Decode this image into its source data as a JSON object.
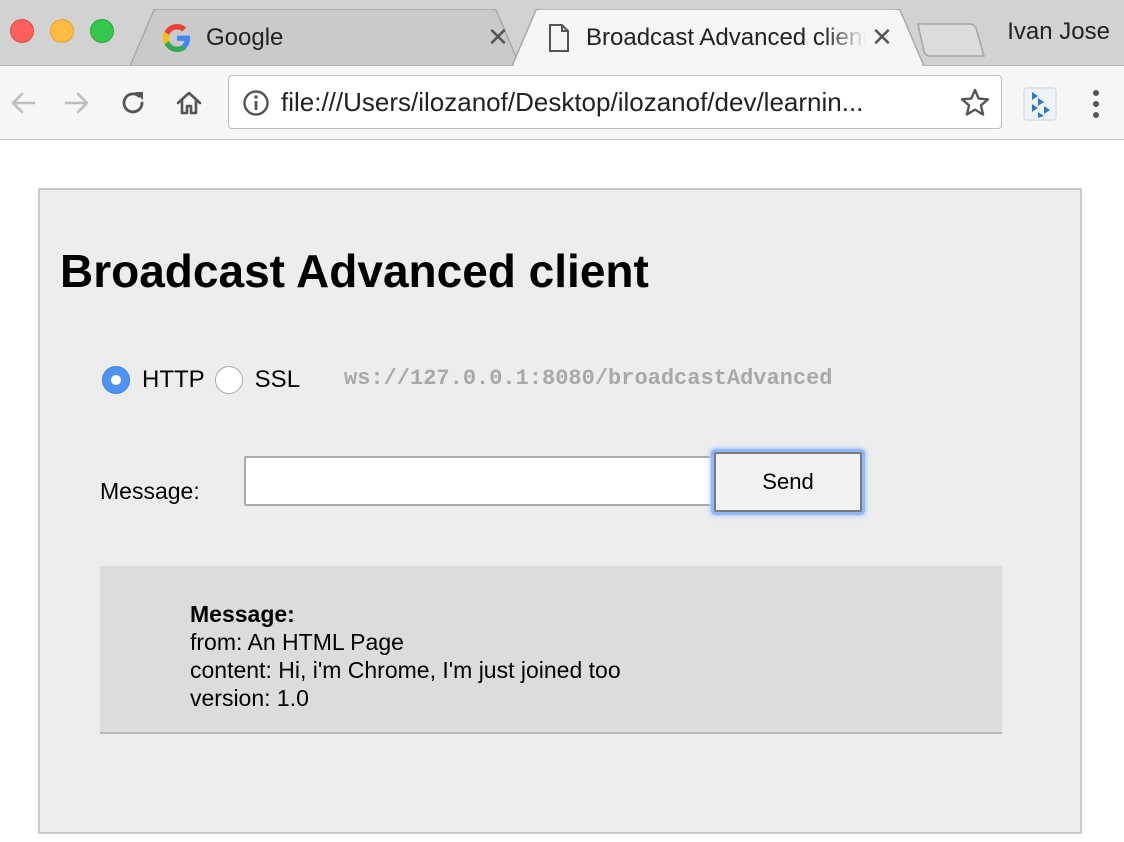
{
  "browser": {
    "tabs": [
      {
        "title": "Google",
        "icon": "google-g-icon",
        "active": false
      },
      {
        "title": "Broadcast Advanced client",
        "icon": "document-icon",
        "active": true
      }
    ],
    "profile_name": "Ivan Jose",
    "address_bar": {
      "url": "file:///Users/ilozanof/Desktop/ilozanof/dev/learnin..."
    }
  },
  "page": {
    "title": "Broadcast Advanced client",
    "protocol": {
      "options": [
        {
          "label": "HTTP",
          "checked": true
        },
        {
          "label": "SSL",
          "checked": false
        }
      ],
      "endpoint": "ws://127.0.0.1:8080/broadcastAdvanced"
    },
    "composer": {
      "label": "Message:",
      "input_value": "",
      "send_label": "Send"
    },
    "received": {
      "heading": "Message:",
      "from": "from: An HTML Page",
      "content": "content: Hi, i'm Chrome, I'm just joined too",
      "version": "version: 1.0"
    }
  },
  "colors": {
    "accent": "#4e92f2",
    "panel_bg": "#ededed",
    "message_bg": "#dcdcdc",
    "endpoint_text": "#a8a8a8"
  }
}
